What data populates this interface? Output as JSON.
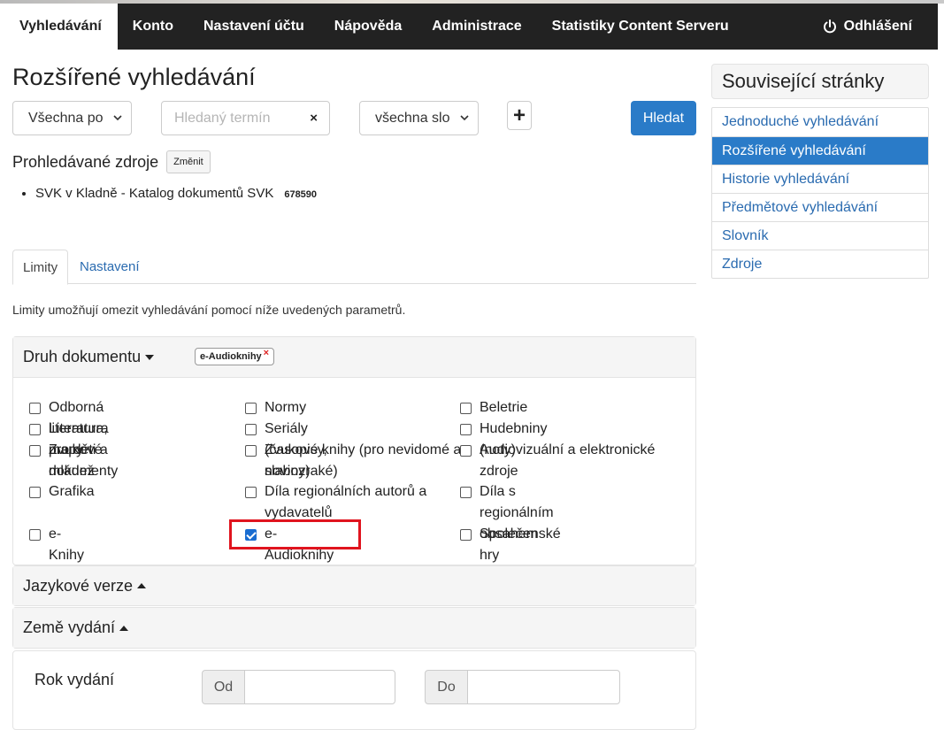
{
  "nav": {
    "items": [
      "Vyhledávání",
      "Konto",
      "Nastavení účtu",
      "Nápověda",
      "Administrace",
      "Statistiky Content Serveru"
    ],
    "logout": "Odhlášení"
  },
  "page": {
    "title": "Rozšířené vyhledávání"
  },
  "search": {
    "field_select": "Všechna po",
    "term_placeholder": "Hledaný termín",
    "clear": "×",
    "words_select": "všechna slo",
    "add": "+",
    "submit": "Hledat"
  },
  "sources": {
    "title": "Prohledávané zdroje",
    "change": "Změnit",
    "items": [
      {
        "name": "SVK v Kladně - Katalog dokumentů SVK",
        "count": "678590"
      }
    ]
  },
  "tabs": [
    "Limity",
    "Nastavení"
  ],
  "limits_description": "Limity umožňují omezit vyhledávání pomocí níže uvedených parametrů.",
  "doc_type": {
    "heading": "Druh dokumentu",
    "active_filter": "e-Audioknihy",
    "active_filter_remove": "×",
    "options": [
      [
        "Odborná literatura, mapy",
        "Normy",
        "Beletrie"
      ],
      [
        "Literatura pro děti a mládež",
        "Seriály (časopisy, noviny)",
        "Hudebniny (noty)"
      ],
      [
        "Zvukové dokumenty",
        "Zvukové knihy (pro nevidomé a",
        "Audiovizuální a elektronické"
      ],
      [
        "",
        "slabozraké)",
        "zdroje"
      ],
      [
        "Grafika",
        "Díla regionálních autorů a",
        "Díla s regionálním obsahem"
      ],
      [
        "",
        "vydavatelů",
        ""
      ],
      [
        "e-Knihy",
        "e-Audioknihy",
        "Společenské hry"
      ]
    ],
    "checked": "e-Audioknihy"
  },
  "language": {
    "heading": "Jazykové verze"
  },
  "country": {
    "heading": "Země vydání"
  },
  "year": {
    "label": "Rok vydání",
    "from": "Od",
    "to": "Do"
  },
  "sidebar": {
    "title": "Související stránky",
    "items": [
      "Jednoduché vyhledávání",
      "Rozšířené vyhledávání",
      "Historie vyhledávání",
      "Předmětové vyhledávání",
      "Slovník",
      "Zdroje"
    ],
    "active": "Rozšířené vyhledávání"
  },
  "colors": {
    "navbar": "#222222",
    "primary": "#2a7bc8",
    "highlight": "#e0141e"
  }
}
